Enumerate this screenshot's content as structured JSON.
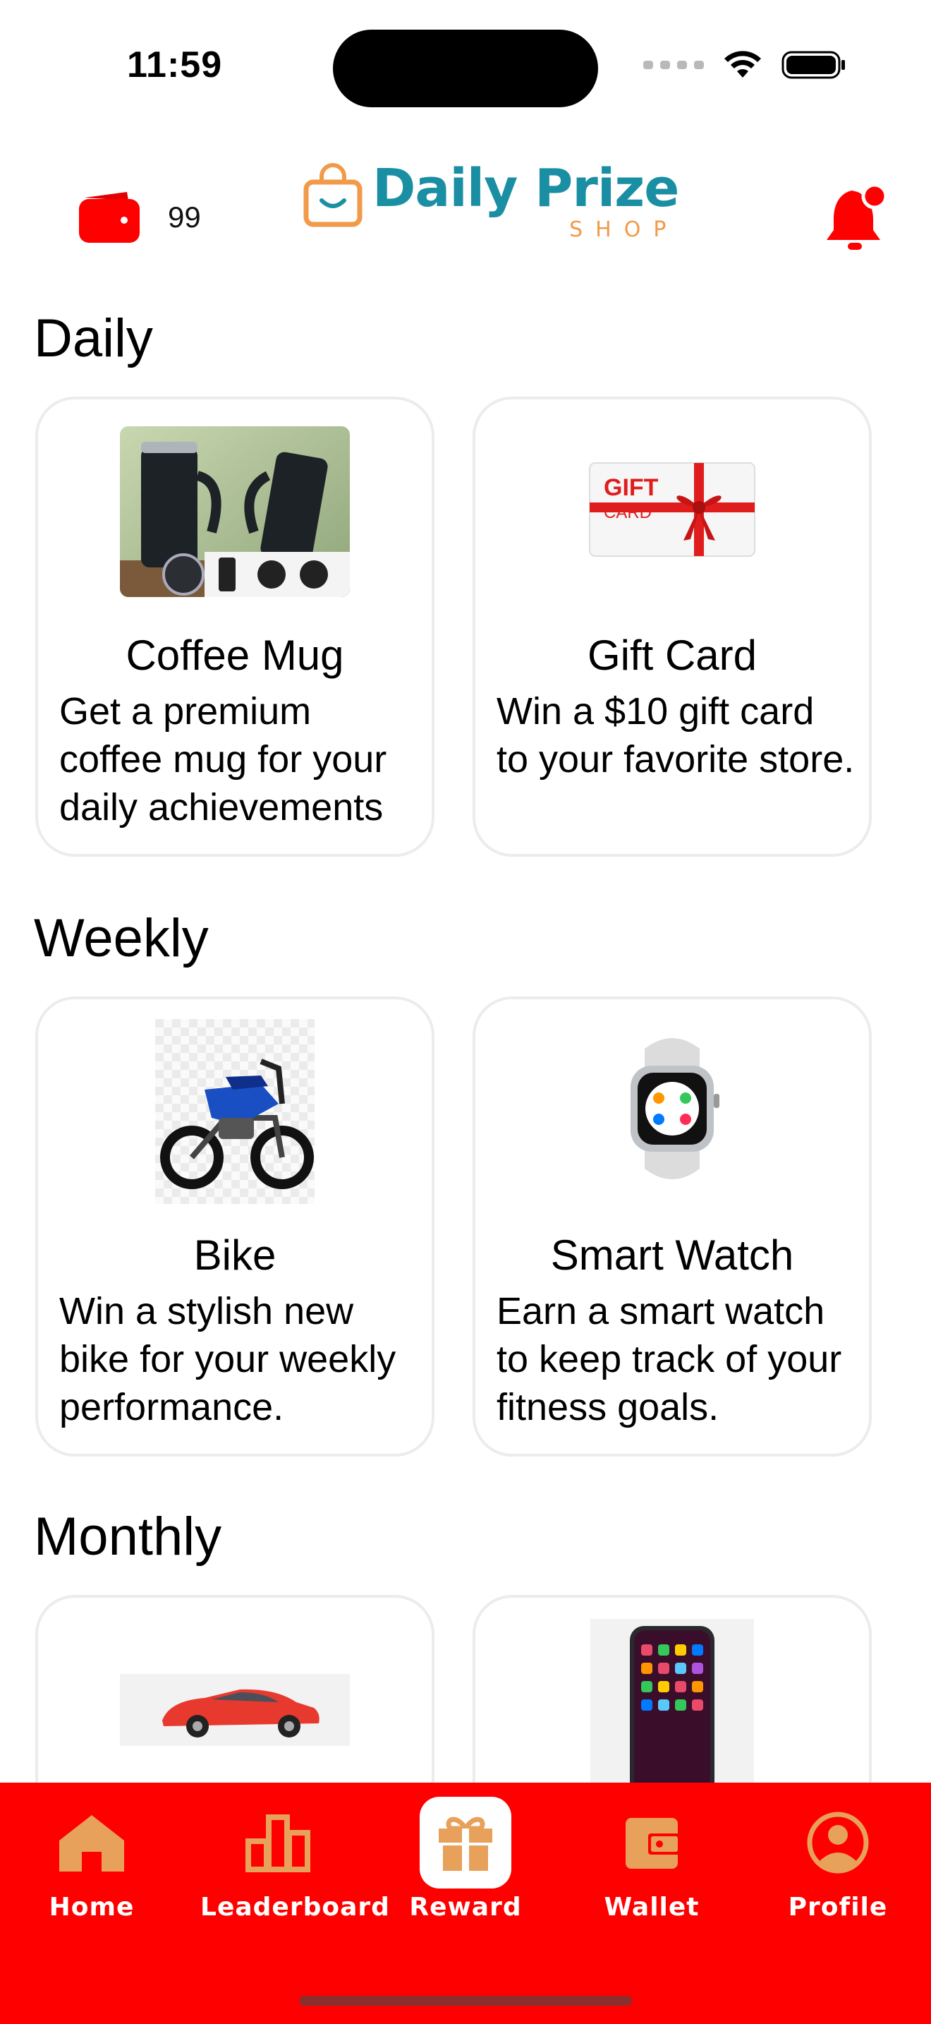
{
  "status_bar": {
    "time": "11:59"
  },
  "header": {
    "wallet_count": "99",
    "logo_main": "Daily Prize",
    "logo_sub": "SHOP"
  },
  "sections": {
    "daily": {
      "title": "Daily",
      "cards": [
        {
          "title": "Coffee Mug",
          "desc": "Get a premium coffee mug for your daily achievements"
        },
        {
          "title": "Gift Card",
          "desc": "Win a $10 gift card to your favorite store.",
          "image_text_1": "GIFT",
          "image_text_2": "CARD"
        }
      ]
    },
    "weekly": {
      "title": "Weekly",
      "cards": [
        {
          "title": "Bike",
          "desc": "Win a stylish new bike for your weekly performance."
        },
        {
          "title": "Smart Watch",
          "desc": "Earn a smart watch to keep track of your fitness goals."
        }
      ]
    },
    "monthly": {
      "title": "Monthly"
    }
  },
  "bottom_nav": {
    "items": [
      {
        "label": "Home",
        "icon": "home-icon"
      },
      {
        "label": "Leaderboard",
        "icon": "leaderboard-icon"
      },
      {
        "label": "Reward",
        "icon": "gift-icon",
        "active": true
      },
      {
        "label": "Wallet",
        "icon": "wallet-icon"
      },
      {
        "label": "Profile",
        "icon": "profile-icon"
      }
    ]
  },
  "colors": {
    "primary": "#ff0000",
    "nav_icon": "#e8a15a",
    "logo_teal": "#1a8fa3",
    "logo_orange": "#f29a4a"
  }
}
